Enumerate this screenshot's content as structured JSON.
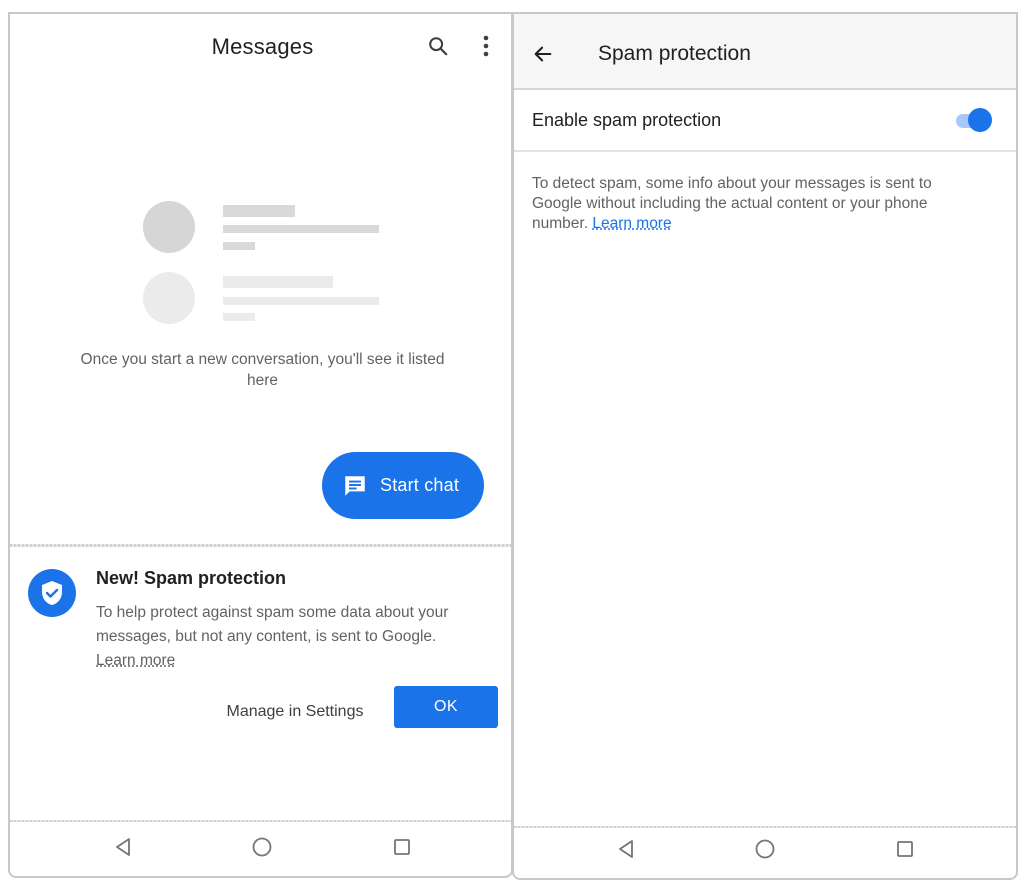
{
  "left_screen": {
    "header": {
      "title": "Messages",
      "search_icon": "search-icon",
      "more_icon": "more-vert-icon"
    },
    "empty_state": {
      "message": "Once you start a new conversation, you'll see it listed here"
    },
    "fab": {
      "label": "Start chat",
      "icon": "chat-icon",
      "color": "#1a73e8"
    },
    "spam_banner": {
      "icon": "shield-check-icon",
      "title": "New! Spam protection",
      "body": "To help protect against spam some data about your messages, but not any content, is sent to Google.",
      "link": "Learn more",
      "secondary_button": "Manage in Settings",
      "primary_button": "OK"
    },
    "nav": {
      "back": "back-triangle-icon",
      "home": "home-circle-icon",
      "recents": "recents-square-icon"
    }
  },
  "right_screen": {
    "header": {
      "back_icon": "arrow-back-icon",
      "title": "Spam protection"
    },
    "setting": {
      "label": "Enable spam protection",
      "enabled": true
    },
    "description": {
      "text": "To detect spam, some info about your messages is sent to Google without including the actual content or your phone number.",
      "link": "Learn more"
    },
    "nav": {
      "back": "back-triangle-icon",
      "home": "home-circle-icon",
      "recents": "recents-square-icon"
    }
  },
  "colors": {
    "accent": "#1a73e8",
    "toggle_track": "#a8c7fa",
    "placeholder_dark": "#d6d6d6",
    "placeholder_light": "#e8e8e8"
  }
}
